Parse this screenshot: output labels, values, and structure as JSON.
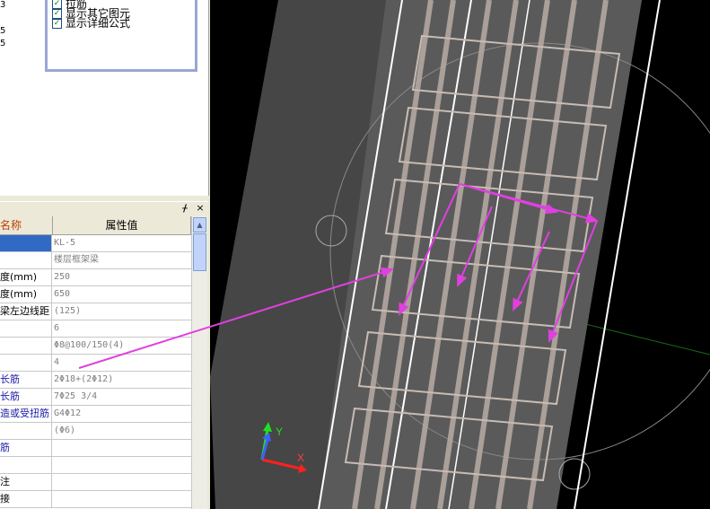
{
  "left_ticks": [
    "3",
    "5",
    "5"
  ],
  "checkboxes": [
    {
      "label": "拉筋",
      "checked": true
    },
    {
      "label": "显示其它图元",
      "checked": true
    },
    {
      "label": "显示详细公式",
      "checked": true
    }
  ],
  "panel": {
    "pin_icon": "pin-icon",
    "close_icon": "close-icon",
    "pin_glyph": "ᚋ",
    "close_glyph": "×",
    "col_name": "名称",
    "col_value": "属性值"
  },
  "rows": [
    {
      "name": "",
      "value": "KL-5",
      "selected": true,
      "blue": false
    },
    {
      "name": "",
      "value": "楼层框架梁",
      "selected": false,
      "blue": false
    },
    {
      "name": "度(mm)",
      "value": "250",
      "selected": false,
      "blue": false
    },
    {
      "name": "度(mm)",
      "value": "650",
      "selected": false,
      "blue": false
    },
    {
      "name": "梁左边线距",
      "value": "(125)",
      "selected": false,
      "blue": false
    },
    {
      "name": "",
      "value": "6",
      "selected": false,
      "blue": false
    },
    {
      "name": "",
      "value": "Φ8@100/150(4)",
      "selected": false,
      "blue": false
    },
    {
      "name": "",
      "value": "4",
      "selected": false,
      "blue": false
    },
    {
      "name": "长筋",
      "value": "2Φ18+(2Φ12)",
      "selected": false,
      "blue": true
    },
    {
      "name": "长筋",
      "value": "7Φ25 3/4",
      "selected": false,
      "blue": true
    },
    {
      "name": "造或受扭筋",
      "value": "G4Φ12",
      "selected": false,
      "blue": true
    },
    {
      "name": "",
      "value": "(Φ6)",
      "selected": false,
      "blue": false
    },
    {
      "name": "筋",
      "value": "",
      "selected": false,
      "blue": true
    },
    {
      "name": "",
      "value": "",
      "selected": false,
      "blue": false
    },
    {
      "name": "注",
      "value": "",
      "selected": false,
      "blue": false
    },
    {
      "name": "接",
      "value": "",
      "selected": false,
      "blue": false
    }
  ],
  "axis": {
    "x_label": "X",
    "y_label": "Y"
  },
  "colors": {
    "panel_bg": "#ece9d8",
    "selection": "#316ac5",
    "annotation_arrow": "#e040e0",
    "model_band": "#4a4a4a",
    "rebar": "#b8aca4",
    "axis_x": "#ff2020",
    "axis_y": "#20e020",
    "axis_z": "#4060ff"
  }
}
